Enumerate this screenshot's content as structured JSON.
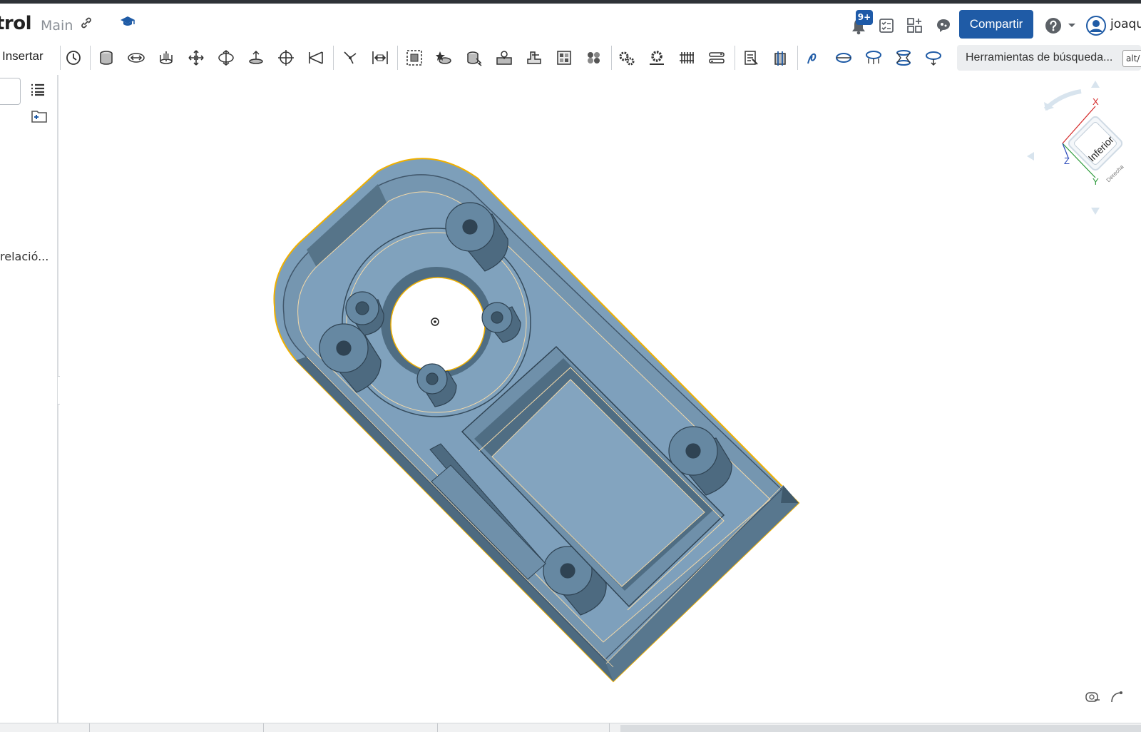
{
  "header": {
    "doc_title": "trol",
    "branch": "Main",
    "notification_count": "9+",
    "share_label": "Compartir",
    "user_name": "joaqui"
  },
  "toolbar": {
    "insert_label": "Insertar",
    "search_label": "Herramientas de búsqueda...",
    "search_shortcut": "alt/"
  },
  "left_panel": {
    "truncated_item": "relació..."
  },
  "view_cube": {
    "face_label": "Inferior",
    "axis_x": "X",
    "axis_y": "Y",
    "axis_z": "Z",
    "side_label": "Derecha"
  },
  "colors": {
    "accent": "#1f5ba6",
    "part_fill": "#7a9cb8",
    "part_edge": "#f0b000"
  }
}
